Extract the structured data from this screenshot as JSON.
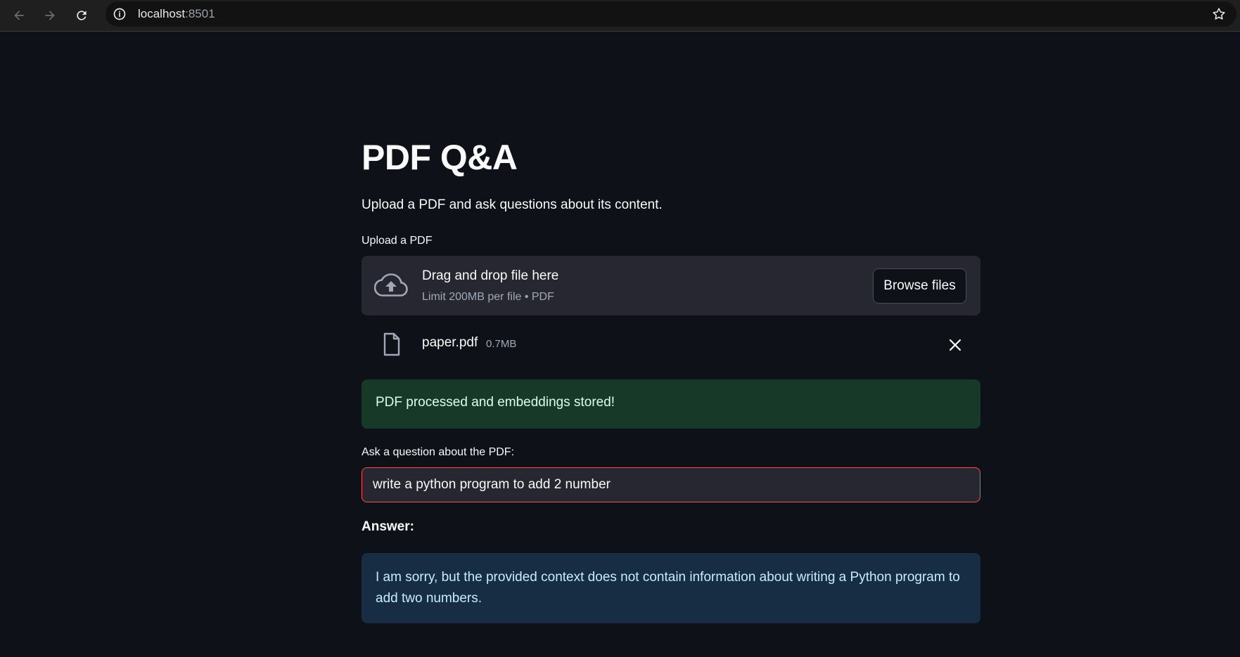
{
  "browser": {
    "url_host": "localhost",
    "url_port": ":8501",
    "icons": [
      "back-arrow-icon",
      "forward-arrow-icon",
      "reload-icon",
      "info-icon",
      "star-icon"
    ]
  },
  "page": {
    "title": "PDF Q&A",
    "subtitle": "Upload a PDF and ask questions about its content."
  },
  "uploader": {
    "label": "Upload a PDF",
    "drop_text": "Drag and drop file here",
    "limit_text": "Limit 200MB per file • PDF",
    "browse_label": "Browse files",
    "icon": "cloud-upload-icon"
  },
  "uploaded_file": {
    "name": "paper.pdf",
    "size": "0.7MB",
    "icon": "file-icon"
  },
  "status": {
    "success_text": "PDF processed and embeddings stored!",
    "color": "#173928"
  },
  "question": {
    "label": "Ask a question about the PDF:",
    "value": "write a python program to add 2 number"
  },
  "answer": {
    "label": "Answer:",
    "text": "I am sorry, but the provided context does not contain information about writing a Python program to add two numbers.",
    "color": "#172d43"
  },
  "colors": {
    "background": "#0e1117",
    "input_border_focus": "#ff4b4b"
  }
}
